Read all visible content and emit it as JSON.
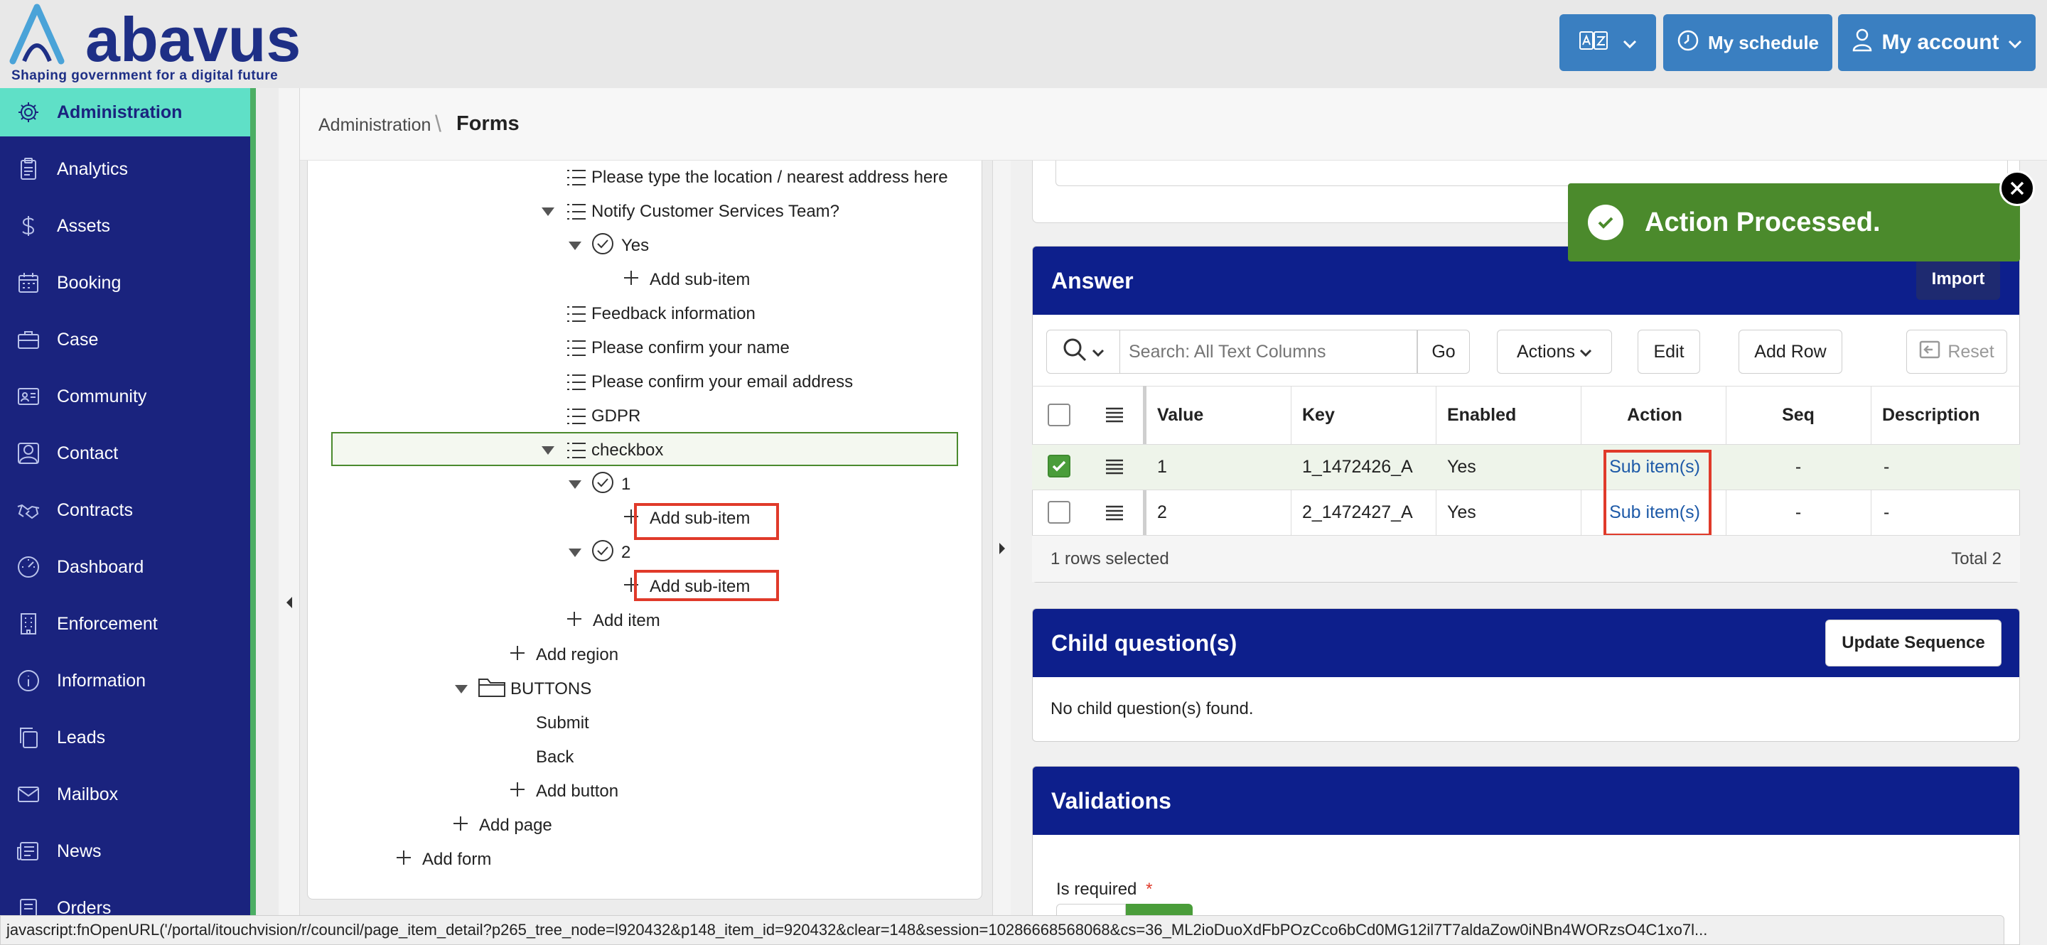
{
  "header": {
    "logo_text": "abavus",
    "tagline": "Shaping government for a digital future",
    "schedule_label": "My schedule",
    "account_label": "My account",
    "translate_icon": "translate-icon",
    "colors": {
      "brand": "#1e2f86",
      "header_button": "#3a7fc1"
    }
  },
  "sidebar": {
    "items": [
      {
        "label": "Administration",
        "icon": "gear-icon"
      },
      {
        "label": "Analytics",
        "icon": "clipboard-icon"
      },
      {
        "label": "Assets",
        "icon": "dollar-icon"
      },
      {
        "label": "Booking",
        "icon": "calendar-icon"
      },
      {
        "label": "Case",
        "icon": "briefcase-icon"
      },
      {
        "label": "Community",
        "icon": "id-card-icon"
      },
      {
        "label": "Contact",
        "icon": "user-icon"
      },
      {
        "label": "Contracts",
        "icon": "handshake-icon"
      },
      {
        "label": "Dashboard",
        "icon": "gauge-icon"
      },
      {
        "label": "Enforcement",
        "icon": "building-icon"
      },
      {
        "label": "Information",
        "icon": "info-icon"
      },
      {
        "label": "Leads",
        "icon": "copy-icon"
      },
      {
        "label": "Mailbox",
        "icon": "envelope-icon"
      },
      {
        "label": "News",
        "icon": "newspaper-icon"
      },
      {
        "label": "Orders",
        "icon": "orders-icon"
      }
    ],
    "active": "Administration",
    "colors": {
      "bg": "#1a237e",
      "active": "#5fe0c7"
    }
  },
  "breadcrumb": {
    "parent": "Administration",
    "separator": "\\",
    "current": "Forms"
  },
  "tree": {
    "rows": [
      {
        "label": "Please type the location / nearest address here"
      },
      {
        "label": "Notify Customer Services Team?"
      },
      {
        "label": "Yes"
      },
      {
        "label": "Add sub-item"
      },
      {
        "label": "Feedback information"
      },
      {
        "label": "Please confirm your name"
      },
      {
        "label": "Please confirm your email address"
      },
      {
        "label": "GDPR"
      },
      {
        "label": "checkbox"
      },
      {
        "label": "1"
      },
      {
        "label": "Add sub-item"
      },
      {
        "label": "2"
      },
      {
        "label": "Add sub-item"
      },
      {
        "label": "Add item"
      },
      {
        "label": "Add region"
      },
      {
        "label": "BUTTONS"
      },
      {
        "label": "Submit"
      },
      {
        "label": "Back"
      },
      {
        "label": "Add button"
      },
      {
        "label": "Add page"
      },
      {
        "label": "Add form"
      }
    ]
  },
  "answer": {
    "title": "Answer",
    "import_label": "Import",
    "search_placeholder": "Search: All Text Columns",
    "go_label": "Go",
    "actions_label": "Actions",
    "edit_label": "Edit",
    "add_row_label": "Add Row",
    "reset_label": "Reset",
    "columns": [
      "Value",
      "Key",
      "Enabled",
      "Action",
      "Seq",
      "Description"
    ],
    "rows": [
      {
        "selected": true,
        "value": "1",
        "key": "1_1472426_A",
        "enabled": "Yes",
        "action": "Sub item(s)",
        "seq": "-",
        "description": "-"
      },
      {
        "selected": false,
        "value": "2",
        "key": "2_1472427_A",
        "enabled": "Yes",
        "action": "Sub item(s)",
        "seq": "-",
        "description": "-"
      }
    ],
    "selection_text": "1 rows selected",
    "total_text": "Total 2"
  },
  "child_questions": {
    "title": "Child question(s)",
    "update_label": "Update Sequence",
    "empty_text": "No child question(s) found."
  },
  "validations": {
    "title": "Validations",
    "is_required_label": "Is required",
    "required_mark": "*"
  },
  "toast": {
    "message": "Action Processed.",
    "color": "#4b8a2c"
  },
  "status_bar": {
    "text": "javascript:fnOpenURL('/portal/itouchvision/r/council/page_item_detail?p265_tree_node=l920432&p148_item_id=920432&clear=148&session=10286668568068&cs=36_ML2ioDuoXdFbPOzCco6bCd0MG12il7T7aldaZow0iNBn4WORzsO4C1xo7l..."
  }
}
